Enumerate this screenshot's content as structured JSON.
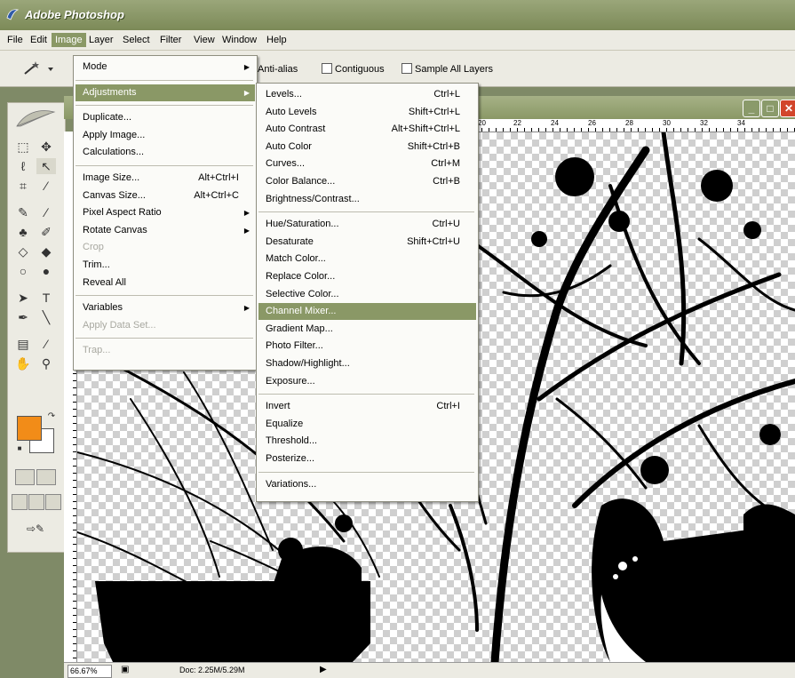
{
  "app": {
    "title": "Adobe Photoshop"
  },
  "menubar": {
    "items": [
      "File",
      "Edit",
      "Image",
      "Layer",
      "Select",
      "Filter",
      "View",
      "Window",
      "Help"
    ],
    "active": "Image"
  },
  "options_bar": {
    "anti_alias": "Anti-alias",
    "contiguous": "Contiguous",
    "sample_all_layers": "Sample All Layers"
  },
  "image_menu": [
    {
      "label": "Mode",
      "shortcut": "",
      "submenu": true,
      "state": "normal"
    },
    {
      "separator": true
    },
    {
      "label": "Adjustments",
      "shortcut": "",
      "submenu": true,
      "state": "highlighted"
    },
    {
      "separator": true
    },
    {
      "label": "Duplicate...",
      "shortcut": "",
      "submenu": false,
      "state": "normal"
    },
    {
      "label": "Apply Image...",
      "shortcut": "",
      "submenu": false,
      "state": "normal"
    },
    {
      "label": "Calculations...",
      "shortcut": "",
      "submenu": false,
      "state": "normal"
    },
    {
      "separator": true
    },
    {
      "label": "Image Size...",
      "shortcut": "Alt+Ctrl+I",
      "submenu": false,
      "state": "normal"
    },
    {
      "label": "Canvas Size...",
      "shortcut": "Alt+Ctrl+C",
      "submenu": false,
      "state": "normal"
    },
    {
      "label": "Pixel Aspect Ratio",
      "shortcut": "",
      "submenu": true,
      "state": "normal"
    },
    {
      "label": "Rotate Canvas",
      "shortcut": "",
      "submenu": true,
      "state": "normal"
    },
    {
      "label": "Crop",
      "shortcut": "",
      "submenu": false,
      "state": "disabled"
    },
    {
      "label": "Trim...",
      "shortcut": "",
      "submenu": false,
      "state": "normal"
    },
    {
      "label": "Reveal All",
      "shortcut": "",
      "submenu": false,
      "state": "normal"
    },
    {
      "separator": true
    },
    {
      "label": "Variables",
      "shortcut": "",
      "submenu": true,
      "state": "normal"
    },
    {
      "label": "Apply Data Set...",
      "shortcut": "",
      "submenu": false,
      "state": "disabled"
    },
    {
      "separator": true
    },
    {
      "label": "Trap...",
      "shortcut": "",
      "submenu": false,
      "state": "disabled"
    }
  ],
  "adjustments_menu": [
    {
      "label": "Levels...",
      "shortcut": "Ctrl+L",
      "state": "normal"
    },
    {
      "label": "Auto Levels",
      "shortcut": "Shift+Ctrl+L",
      "state": "normal"
    },
    {
      "label": "Auto Contrast",
      "shortcut": "Alt+Shift+Ctrl+L",
      "state": "normal"
    },
    {
      "label": "Auto Color",
      "shortcut": "Shift+Ctrl+B",
      "state": "normal"
    },
    {
      "label": "Curves...",
      "shortcut": "Ctrl+M",
      "state": "normal"
    },
    {
      "label": "Color Balance...",
      "shortcut": "Ctrl+B",
      "state": "normal"
    },
    {
      "label": "Brightness/Contrast...",
      "shortcut": "",
      "state": "normal"
    },
    {
      "separator": true
    },
    {
      "label": "Hue/Saturation...",
      "shortcut": "Ctrl+U",
      "state": "normal"
    },
    {
      "label": "Desaturate",
      "shortcut": "Shift+Ctrl+U",
      "state": "normal"
    },
    {
      "label": "Match Color...",
      "shortcut": "",
      "state": "normal"
    },
    {
      "label": "Replace Color...",
      "shortcut": "",
      "state": "normal"
    },
    {
      "label": "Selective Color...",
      "shortcut": "",
      "state": "normal"
    },
    {
      "label": "Channel Mixer...",
      "shortcut": "",
      "state": "highlighted"
    },
    {
      "label": "Gradient Map...",
      "shortcut": "",
      "state": "normal"
    },
    {
      "label": "Photo Filter...",
      "shortcut": "",
      "state": "normal"
    },
    {
      "label": "Shadow/Highlight...",
      "shortcut": "",
      "state": "normal"
    },
    {
      "label": "Exposure...",
      "shortcut": "",
      "state": "normal"
    },
    {
      "separator": true
    },
    {
      "label": "Invert",
      "shortcut": "Ctrl+I",
      "state": "normal"
    },
    {
      "label": "Equalize",
      "shortcut": "",
      "state": "normal"
    },
    {
      "label": "Threshold...",
      "shortcut": "",
      "state": "normal"
    },
    {
      "label": "Posterize...",
      "shortcut": "",
      "state": "normal"
    },
    {
      "separator": true
    },
    {
      "label": "Variations...",
      "shortcut": "",
      "state": "normal"
    }
  ],
  "ruler": {
    "labels": [
      "20",
      "22",
      "24",
      "26",
      "28",
      "30",
      "32",
      "34"
    ]
  },
  "status_bar": {
    "zoom": "66.67%",
    "doc_info": "Doc: 2.25M/5.29M"
  },
  "colors": {
    "accent": "#8a9866",
    "foreground_swatch": "#f28c18",
    "background_swatch": "#ffffff"
  }
}
